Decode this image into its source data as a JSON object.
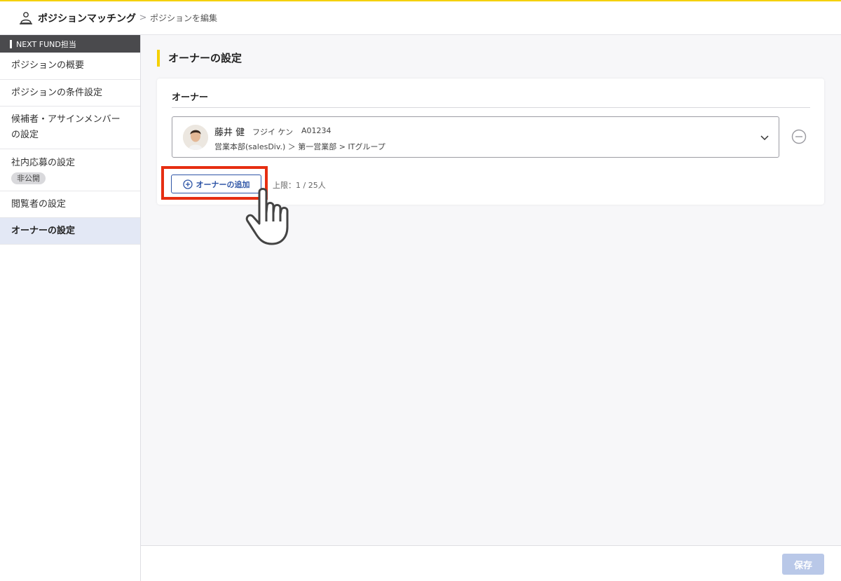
{
  "header": {
    "app_title": "ポジションマッチング",
    "separator": ">",
    "breadcrumb": "ポジションを編集"
  },
  "sidebar": {
    "group_label": "NEXT FUND担当",
    "items": [
      {
        "lines": [
          "ポジションの概要"
        ]
      },
      {
        "lines": [
          "ポジションの条件設定"
        ]
      },
      {
        "lines": [
          "候補者・アサインメンバー",
          "の設定"
        ]
      },
      {
        "lines": [
          "社内応募の設定"
        ],
        "badge": "非公開"
      },
      {
        "lines": [
          "閲覧者の設定"
        ]
      },
      {
        "lines": [
          "オーナーの設定"
        ],
        "active": true
      }
    ]
  },
  "main": {
    "section_title": "オーナーの設定",
    "card_label": "オーナー",
    "owner": {
      "name": "藤井 健",
      "kana": "フジイ ケン",
      "employee_id": "A01234",
      "department": "営業本部(salesDiv.) ＞ 第一営業部 > ITグループ"
    },
    "add_button_label": "オーナーの追加",
    "limit_text": "上限：1 / 25人"
  },
  "footer": {
    "save_label": "保存"
  },
  "colors": {
    "accent_yellow": "#f5d000",
    "primary_blue": "#2f56a7",
    "highlight_red": "#e62e12",
    "save_disabled": "#b9c8e8",
    "active_item_bg": "#e3e8f5"
  }
}
